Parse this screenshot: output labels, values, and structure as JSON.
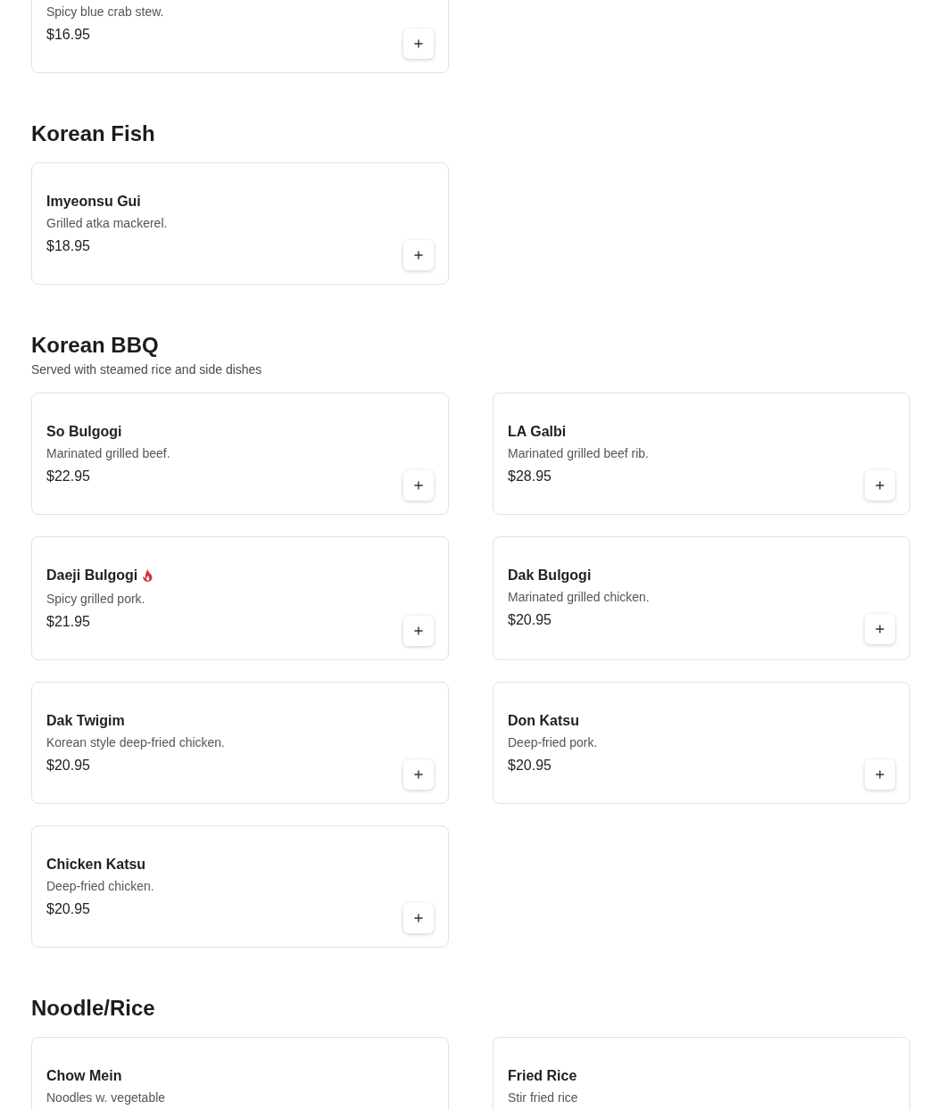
{
  "sections": [
    {
      "items": [
        {
          "description": "Spicy blue crab stew.",
          "price": "$16.95",
          "spicy": false
        }
      ]
    },
    {
      "title": "Korean Fish",
      "items": [
        {
          "name": "Imyeonsu Gui",
          "description": "Grilled atka mackerel.",
          "price": "$18.95",
          "spicy": false
        }
      ]
    },
    {
      "title": "Korean BBQ",
      "subtitle": "Served with steamed rice and side dishes",
      "items": [
        {
          "name": "So Bulgogi",
          "description": "Marinated grilled beef.",
          "price": "$22.95",
          "spicy": false
        },
        {
          "name": "LA Galbi",
          "description": "Marinated grilled beef rib.",
          "price": "$28.95",
          "spicy": false
        },
        {
          "name": "Daeji Bulgogi",
          "description": "Spicy grilled pork.",
          "price": "$21.95",
          "spicy": true
        },
        {
          "name": "Dak Bulgogi",
          "description": "Marinated grilled chicken.",
          "price": "$20.95",
          "spicy": false
        },
        {
          "name": "Dak Twigim",
          "description": "Korean style deep-fried chicken.",
          "price": "$20.95",
          "spicy": false
        },
        {
          "name": "Don Katsu",
          "description": "Deep-fried pork.",
          "price": "$20.95",
          "spicy": false
        },
        {
          "name": "Chicken Katsu",
          "description": "Deep-fried chicken.",
          "price": "$20.95",
          "spicy": false
        }
      ]
    },
    {
      "title": "Noodle/Rice",
      "items": [
        {
          "name": "Chow Mein",
          "description": "Noodles w. vegetable",
          "spicy": false
        },
        {
          "name": "Fried Rice",
          "description": "Stir fried rice",
          "spicy": false
        }
      ]
    }
  ]
}
